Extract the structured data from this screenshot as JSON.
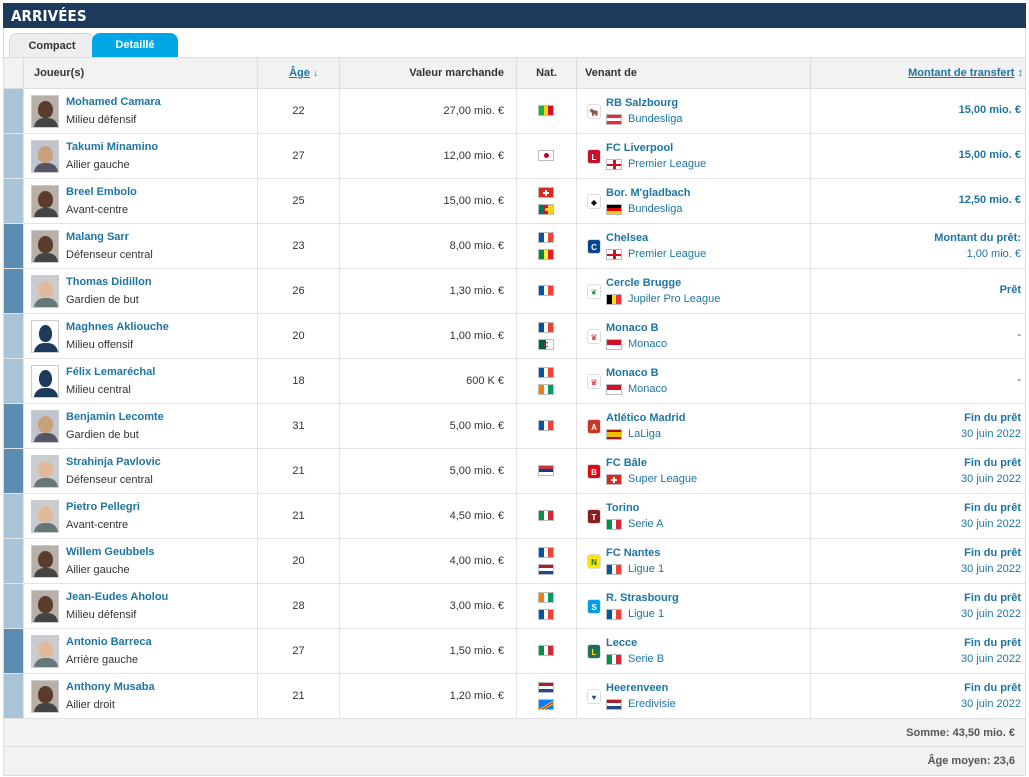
{
  "header": {
    "title": "ARRIVÉES"
  },
  "tabs": [
    {
      "label": "Compact",
      "active": false
    },
    {
      "label": "Detaillé",
      "active": true
    }
  ],
  "columns": {
    "player": "Joueur(s)",
    "age": "Âge",
    "age_sort_icon": "↓",
    "value": "Valeur marchande",
    "nat": "Nat.",
    "from": "Venant de",
    "fee": "Montant de transfert",
    "fee_sort_icon": "↕"
  },
  "rows": [
    {
      "name": "Mohamed Camara",
      "position": "Milieu défensif",
      "age": "22",
      "value": "27,00 mio. €",
      "nat": [
        "mali"
      ],
      "club": "RB Salzbourg",
      "club_logo": "rb",
      "league_flag": "austria",
      "league": "Bundesliga",
      "fee_main": "15,00 mio. €",
      "stripe": "light",
      "photo": "dark"
    },
    {
      "name": "Takumi Minamino",
      "position": "Ailier gauche",
      "age": "27",
      "value": "12,00 mio. €",
      "nat": [
        "japan"
      ],
      "club": "FC Liverpool",
      "club_logo": "liverpool",
      "league_flag": "england",
      "league": "Premier League",
      "fee_main": "15,00 mio. €",
      "stripe": "light",
      "photo": "medium"
    },
    {
      "name": "Breel Embolo",
      "position": "Avant-centre",
      "age": "25",
      "value": "15,00 mio. €",
      "nat": [
        "switzerland",
        "cameroon"
      ],
      "club": "Bor. M'gladbach",
      "club_logo": "gladbach",
      "league_flag": "germany",
      "league": "Bundesliga",
      "fee_main": "12,50 mio. €",
      "stripe": "light",
      "photo": "dark"
    },
    {
      "name": "Malang Sarr",
      "position": "Défenseur central",
      "age": "23",
      "value": "8,00 mio. €",
      "nat": [
        "france",
        "senegal"
      ],
      "club": "Chelsea",
      "club_logo": "chelsea",
      "league_flag": "england",
      "league": "Premier League",
      "fee_top": "Montant du prêt:",
      "fee_bottom": "1,00 mio. €",
      "stripe": "dark",
      "photo": "dark"
    },
    {
      "name": "Thomas Didillon",
      "position": "Gardien de but",
      "age": "26",
      "value": "1,30 mio. €",
      "nat": [
        "france"
      ],
      "club": "Cercle Brugge",
      "club_logo": "cercle",
      "league_flag": "belgium",
      "league": "Jupiler Pro League",
      "fee_main": "Prêt",
      "stripe": "dark",
      "photo": "light"
    },
    {
      "name": "Maghnes Akliouche",
      "position": "Milieu offensif",
      "age": "20",
      "value": "1,00 mio. €",
      "nat": [
        "france",
        "algeria"
      ],
      "club": "Monaco B",
      "club_logo": "monaco",
      "league_flag": "monaco",
      "league": "Monaco",
      "fee_dash": "-",
      "stripe": "light",
      "photo": "silhouette"
    },
    {
      "name": "Félix Lemaréchal",
      "position": "Milieu central",
      "age": "18",
      "value": "600 K €",
      "nat": [
        "france",
        "ivorycoast"
      ],
      "club": "Monaco B",
      "club_logo": "monaco",
      "league_flag": "monaco",
      "league": "Monaco",
      "fee_dash": "-",
      "stripe": "light",
      "photo": "silhouette"
    },
    {
      "name": "Benjamin Lecomte",
      "position": "Gardien de but",
      "age": "31",
      "value": "5,00 mio. €",
      "nat": [
        "france"
      ],
      "club": "Atlético Madrid",
      "club_logo": "atletico",
      "league_flag": "spain",
      "league": "LaLiga",
      "fee_top": "Fin du prêt",
      "fee_bottom": "30 juin 2022",
      "stripe": "dark",
      "photo": "medium"
    },
    {
      "name": "Strahinja Pavlovic",
      "position": "Défenseur central",
      "age": "21",
      "value": "5,00 mio. €",
      "nat": [
        "serbia"
      ],
      "club": "FC Bâle",
      "club_logo": "basel",
      "league_flag": "switzerland",
      "league": "Super League",
      "fee_top": "Fin du prêt",
      "fee_bottom": "30 juin 2022",
      "stripe": "dark",
      "photo": "light"
    },
    {
      "name": "Pietro Pellegri",
      "position": "Avant-centre",
      "age": "21",
      "value": "4,50 mio. €",
      "nat": [
        "italy"
      ],
      "club": "Torino",
      "club_logo": "torino",
      "league_flag": "italy",
      "league": "Serie A",
      "fee_top": "Fin du prêt",
      "fee_bottom": "30 juin 2022",
      "stripe": "light",
      "photo": "light"
    },
    {
      "name": "Willem Geubbels",
      "position": "Ailier gauche",
      "age": "20",
      "value": "4,00 mio. €",
      "nat": [
        "france",
        "netherlands"
      ],
      "club": "FC Nantes",
      "club_logo": "nantes",
      "league_flag": "france",
      "league": "Ligue 1",
      "fee_top": "Fin du prêt",
      "fee_bottom": "30 juin 2022",
      "stripe": "light",
      "photo": "dark"
    },
    {
      "name": "Jean-Eudes Aholou",
      "position": "Milieu défensif",
      "age": "28",
      "value": "3,00 mio. €",
      "nat": [
        "ivorycoast",
        "france"
      ],
      "club": "R. Strasbourg",
      "club_logo": "strasbourg",
      "league_flag": "france",
      "league": "Ligue 1",
      "fee_top": "Fin du prêt",
      "fee_bottom": "30 juin 2022",
      "stripe": "light",
      "photo": "dark"
    },
    {
      "name": "Antonio Barreca",
      "position": "Arrière gauche",
      "age": "27",
      "value": "1,50 mio. €",
      "nat": [
        "italy"
      ],
      "club": "Lecce",
      "club_logo": "lecce",
      "league_flag": "italy",
      "league": "Serie B",
      "fee_top": "Fin du prêt",
      "fee_bottom": "30 juin 2022",
      "stripe": "dark",
      "photo": "light"
    },
    {
      "name": "Anthony Musaba",
      "position": "Ailier droit",
      "age": "21",
      "value": "1,20 mio. €",
      "nat": [
        "netherlands",
        "drcongo"
      ],
      "club": "Heerenveen",
      "club_logo": "heerenveen",
      "league_flag": "netherlands",
      "league": "Eredivisie",
      "fee_top": "Fin du prêt",
      "fee_bottom": "30 juin 2022",
      "stripe": "light",
      "photo": "dark"
    }
  ],
  "summary": {
    "sum": "Somme: 43,50 mio. €",
    "avg": "Âge moyen: 23,6"
  },
  "colors": {
    "header_bg": "#1d3a5c",
    "tab_active": "#00a6e6",
    "link": "#1d75a3"
  }
}
